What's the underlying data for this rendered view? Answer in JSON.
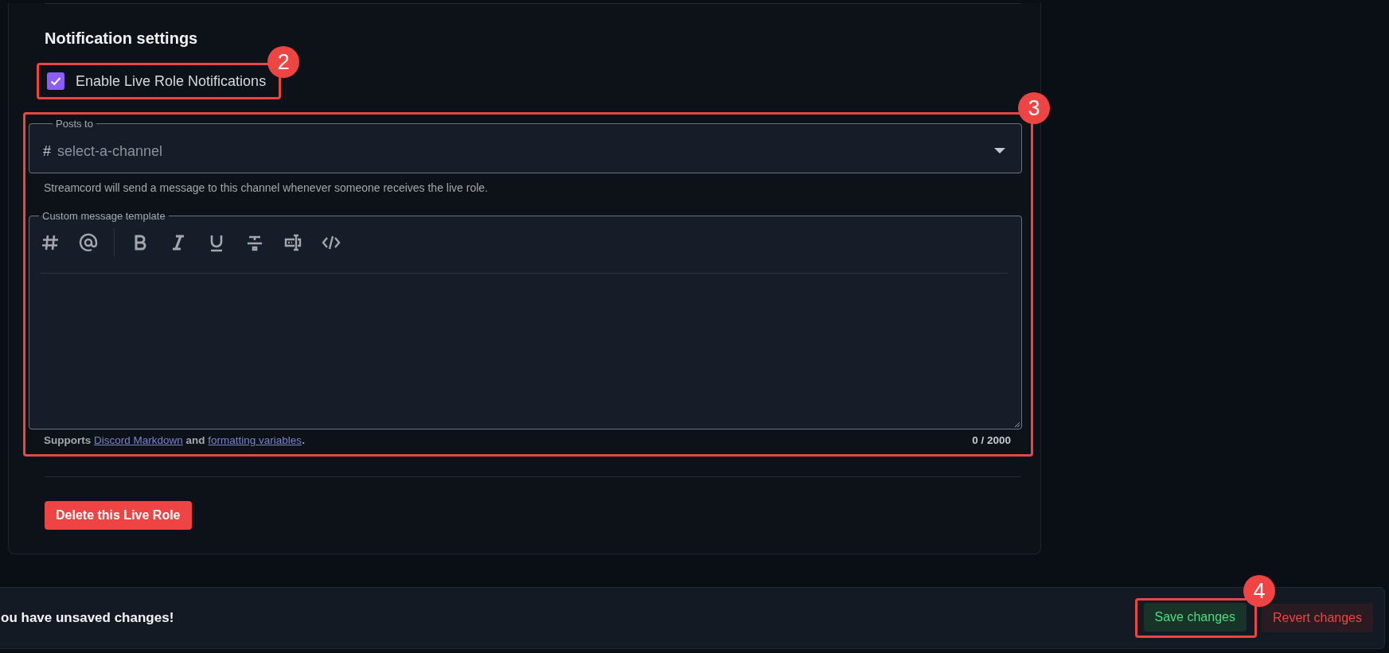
{
  "section": {
    "title": "Notification settings"
  },
  "notify_toggle": {
    "label": "Enable Live Role Notifications",
    "checked": true,
    "annotation": "2"
  },
  "channel_config": {
    "annotation": "3",
    "posts_to": {
      "legend": "Posts to",
      "prefix": "#",
      "placeholder": "select-a-channel",
      "help": "Streamcord will send a message to this channel whenever someone receives the live role."
    },
    "template": {
      "legend": "Custom message template",
      "toolbar": [
        {
          "kind": "channel"
        },
        {
          "kind": "mention"
        },
        {
          "kind": "separator"
        },
        {
          "kind": "bold"
        },
        {
          "kind": "italic"
        },
        {
          "kind": "underline"
        },
        {
          "kind": "strike"
        },
        {
          "kind": "textbox"
        },
        {
          "kind": "code"
        }
      ],
      "footer": {
        "before": "Supports ",
        "link_1": "Discord Markdown",
        "middle": " and ",
        "link_2": "formatting variables",
        "after": "."
      },
      "counter": "0 / 2000"
    }
  },
  "delete_button": "Delete this Live Role",
  "unsaved_bar": {
    "message": "ou have unsaved changes!",
    "save": "Save changes",
    "save_annotation": "4",
    "revert": "Revert changes"
  }
}
